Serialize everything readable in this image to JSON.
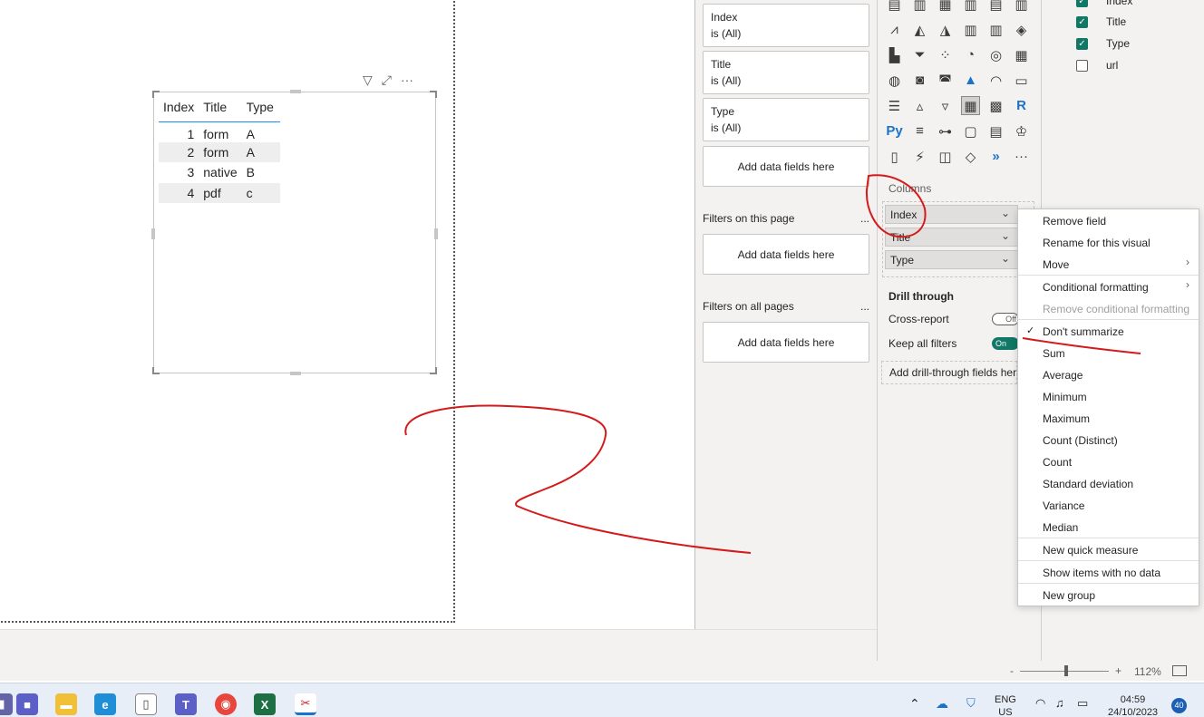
{
  "visual": {
    "headers": [
      "Index",
      "Title",
      "Type"
    ],
    "rows": [
      {
        "index": "1",
        "title": "form",
        "type": "A"
      },
      {
        "index": "2",
        "title": "form",
        "type": "A"
      },
      {
        "index": "3",
        "title": "native",
        "type": "B"
      },
      {
        "index": "4",
        "title": "pdf",
        "type": "c"
      }
    ],
    "header_icons": [
      "filter-icon",
      "focus-mode-icon",
      "more-options-icon"
    ]
  },
  "filters": {
    "cards": [
      {
        "field": "Index",
        "state": "is (All)"
      },
      {
        "field": "Title",
        "state": "is (All)"
      },
      {
        "field": "Type",
        "state": "is (All)"
      }
    ],
    "add_data_fields": "Add data fields here",
    "on_this_page": "Filters on this page",
    "on_all_pages": "Filters on all pages",
    "more": "..."
  },
  "viz": {
    "columns_label": "Columns",
    "column_pills": [
      "Index",
      "Title",
      "Type"
    ],
    "drill_through": "Drill through",
    "cross_report": "Cross-report",
    "cross_report_toggle": "Off",
    "keep_all_filters": "Keep all filters",
    "keep_all_filters_toggle": "On",
    "add_drill": "Add drill-through fields here"
  },
  "fields": {
    "items": [
      {
        "label": "Index",
        "checked": true
      },
      {
        "label": "Title",
        "checked": true
      },
      {
        "label": "Type",
        "checked": true
      },
      {
        "label": "url",
        "checked": false
      }
    ]
  },
  "context_menu": {
    "remove_field": "Remove field",
    "rename": "Rename for this visual",
    "move": "Move",
    "conditional_formatting": "Conditional formatting",
    "remove_conditional_formatting": "Remove conditional formatting",
    "dont_summarize": "Don't summarize",
    "sum": "Sum",
    "average": "Average",
    "minimum": "Minimum",
    "maximum": "Maximum",
    "count_distinct": "Count (Distinct)",
    "count": "Count",
    "std_dev": "Standard deviation",
    "variance": "Variance",
    "median": "Median",
    "new_quick_measure": "New quick measure",
    "show_items_no_data": "Show items with no data",
    "new_group": "New group"
  },
  "status": {
    "zoom": "112%",
    "minus": "-",
    "plus": "+"
  },
  "taskbar": {
    "lang_top": "ENG",
    "lang_bottom": "US",
    "time": "04:59",
    "date": "24/10/2023",
    "notifications": "40"
  },
  "colors": {
    "accent": "#118dff",
    "toggle_on": "#117865",
    "ink": "#d41a1a"
  }
}
